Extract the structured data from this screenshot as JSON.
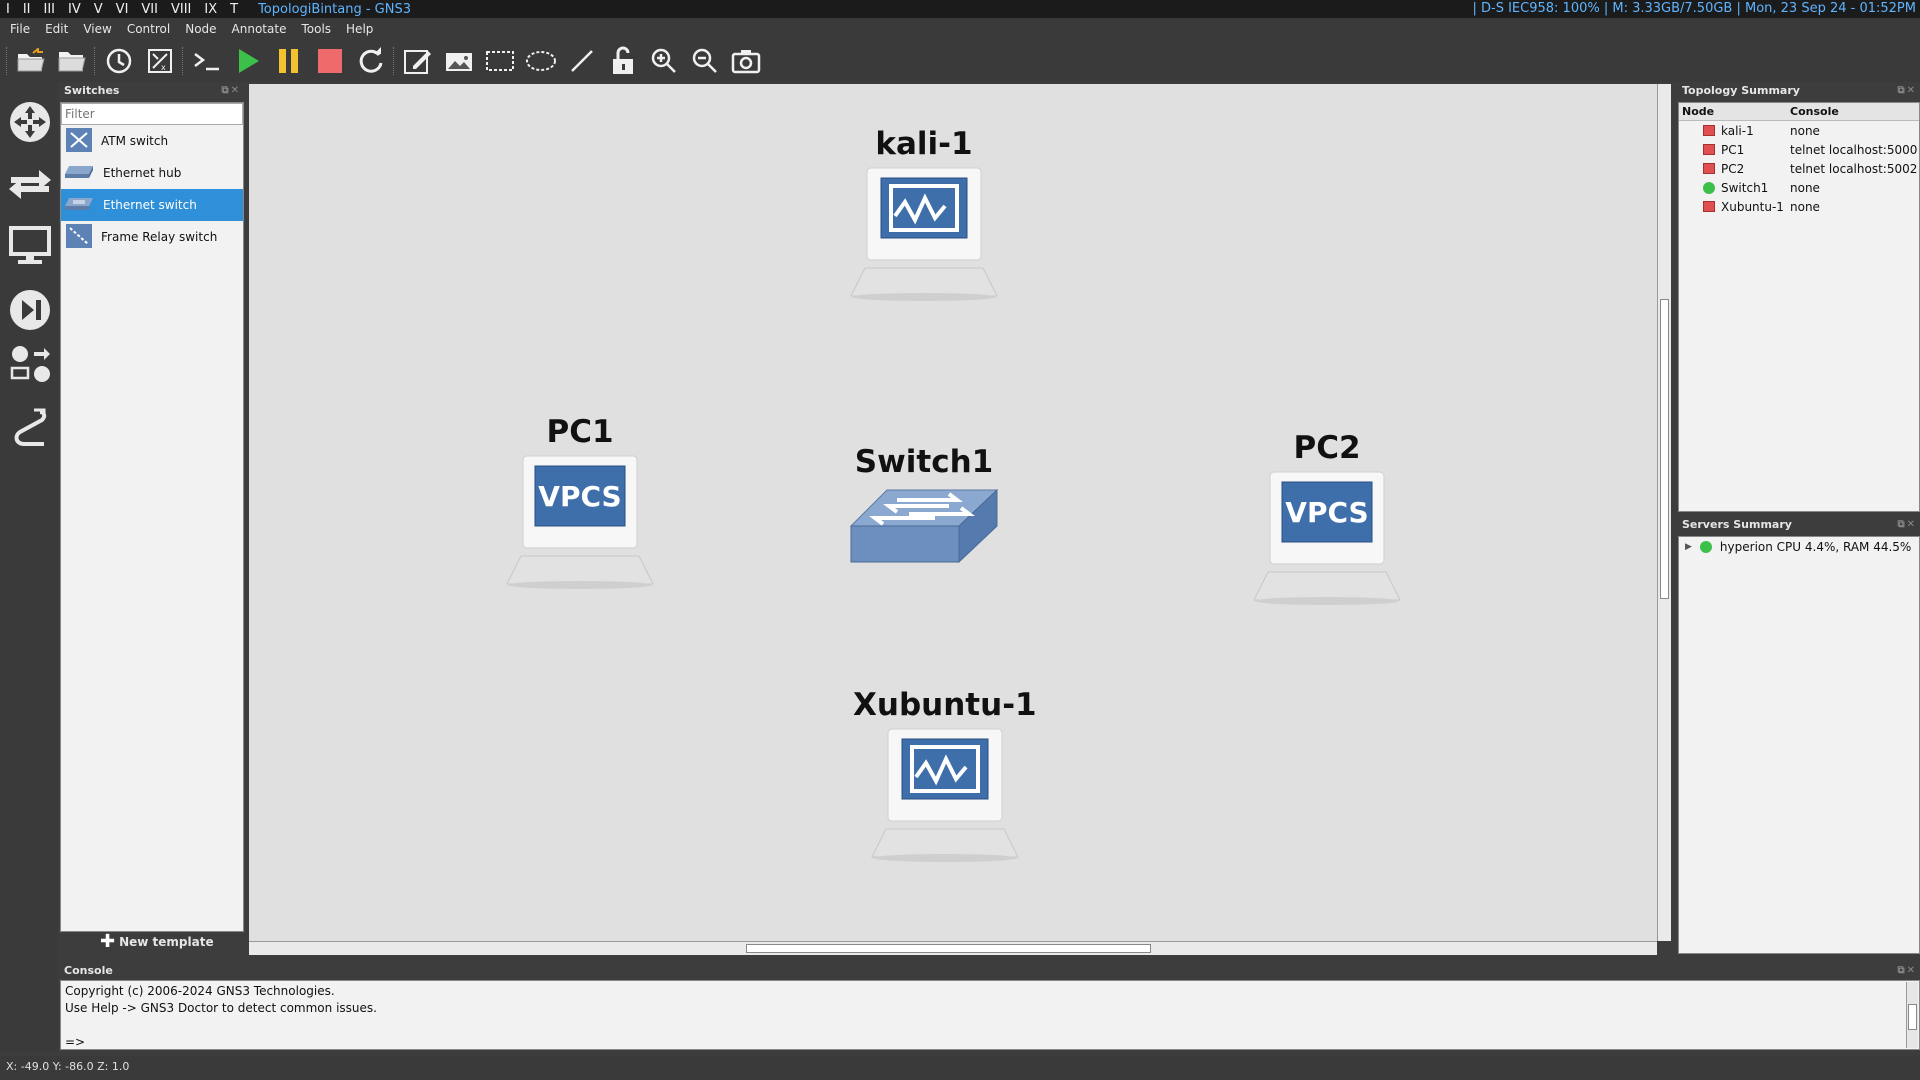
{
  "topbar": {
    "workspaces": [
      "I",
      "II",
      "III",
      "IV",
      "V",
      "VI",
      "VII",
      "VIII",
      "IX",
      "T"
    ],
    "window_title": "TopologiBintang - GNS3",
    "system_status": "| D-S IEC958: 100% | M: 3.33GB/7.50GB | Mon, 23 Sep 24 - 01:52PM"
  },
  "menu": [
    "File",
    "Edit",
    "View",
    "Control",
    "Node",
    "Annotate",
    "Tools",
    "Help"
  ],
  "toolbar_icons": [
    "open-project-icon",
    "open-folder-icon",
    "snapshot-clock-icon",
    "show-interface-labels-icon",
    "console-all-icon",
    "start-all-icon",
    "suspend-all-icon",
    "stop-all-icon",
    "reload-all-icon",
    "add-note-icon",
    "insert-image-icon",
    "draw-rectangle-icon",
    "draw-ellipse-icon",
    "draw-line-icon",
    "lock-icon",
    "zoom-in-icon",
    "zoom-out-icon",
    "screenshot-icon"
  ],
  "switches_panel": {
    "title": "Switches",
    "filter_placeholder": "Filter",
    "items": [
      {
        "label": "ATM switch",
        "icon": "atm-switch-icon",
        "selected": false
      },
      {
        "label": "Ethernet hub",
        "icon": "ethernet-hub-icon",
        "selected": false
      },
      {
        "label": "Ethernet switch",
        "icon": "ethernet-switch-icon",
        "selected": true
      },
      {
        "label": "Frame Relay switch",
        "icon": "frame-relay-switch-icon",
        "selected": false
      }
    ],
    "new_template": "New template"
  },
  "canvas": {
    "nodes": [
      {
        "name": "kali-1",
        "type": "vm"
      },
      {
        "name": "PC1",
        "type": "vpcs",
        "screen_text": "VPCS"
      },
      {
        "name": "Switch1",
        "type": "switch"
      },
      {
        "name": "PC2",
        "type": "vpcs",
        "screen_text": "VPCS"
      },
      {
        "name": "Xubuntu-1",
        "type": "vm"
      }
    ]
  },
  "topology_summary": {
    "title": "Topology Summary",
    "columns": [
      "Node",
      "Console"
    ],
    "rows": [
      {
        "node": "kali-1",
        "console": "none",
        "status": "stopped"
      },
      {
        "node": "PC1",
        "console": "telnet localhost:5000",
        "status": "stopped"
      },
      {
        "node": "PC2",
        "console": "telnet localhost:5002",
        "status": "stopped"
      },
      {
        "node": "Switch1",
        "console": "none",
        "status": "started"
      },
      {
        "node": "Xubuntu-1",
        "console": "none",
        "status": "stopped"
      }
    ]
  },
  "servers_summary": {
    "title": "Servers Summary",
    "server": "hyperion CPU 4.4%, RAM 44.5%"
  },
  "console": {
    "title": "Console",
    "line1": "Copyright (c) 2006-2024 GNS3 Technologies.",
    "line2": "Use Help -> GNS3 Doctor to detect common issues.",
    "prompt": "=>"
  },
  "statusbar": {
    "coords": "X: -49.0 Y: -86.0 Z: 1.0"
  },
  "colors": {
    "accent": "#2f8fd8",
    "title_blue": "#5fb4ff",
    "stopped": "#e05050",
    "started": "#3cc04a",
    "canvas": "#e0e0e0"
  }
}
